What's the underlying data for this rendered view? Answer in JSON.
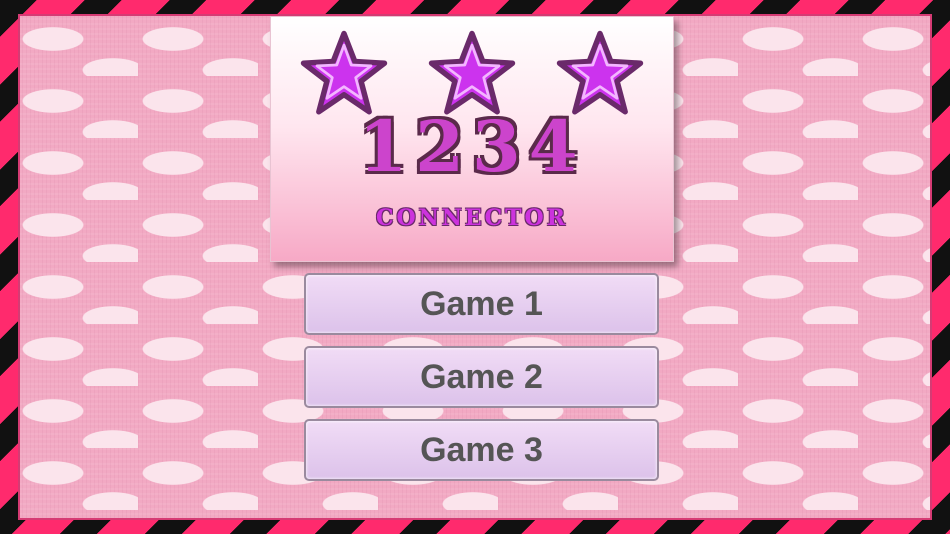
{
  "logo": {
    "numbers": "1234",
    "subtitle": "CONNECTOR",
    "star_fill": "#cc33ee",
    "star_outline": "#6a2a6a"
  },
  "menu": {
    "buttons": [
      {
        "label": "Game 1"
      },
      {
        "label": "Game 2"
      },
      {
        "label": "Game 3"
      }
    ]
  },
  "colors": {
    "border_pink": "#ff2a6d",
    "border_black": "#111111",
    "background_pink": "#f2a9c3",
    "button_lavender": "#e8d0f2"
  }
}
